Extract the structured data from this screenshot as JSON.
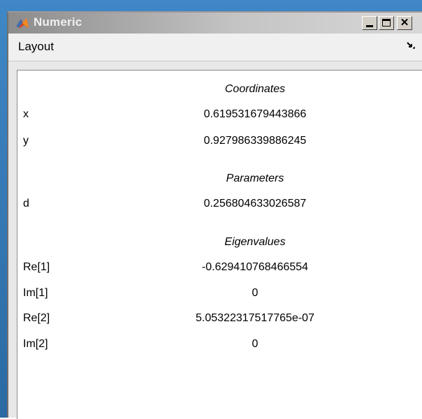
{
  "window": {
    "title": "Numeric"
  },
  "menu": {
    "layout_label": "Layout"
  },
  "sections": {
    "coordinates": {
      "header": "Coordinates",
      "rows": [
        {
          "label": "x",
          "value": "0.619531679443866"
        },
        {
          "label": "y",
          "value": "0.927986339886245"
        }
      ]
    },
    "parameters": {
      "header": "Parameters",
      "rows": [
        {
          "label": "d",
          "value": "0.256804633026587"
        }
      ]
    },
    "eigenvalues": {
      "header": "Eigenvalues",
      "rows": [
        {
          "label": "Re[1]",
          "value": "-0.629410768466554"
        },
        {
          "label": "Im[1]",
          "value": "0"
        },
        {
          "label": "Re[2]",
          "value": "5.05322317517765e-07"
        },
        {
          "label": "Im[2]",
          "value": "0"
        }
      ]
    }
  },
  "icons": {
    "app": "matlab-logo-icon",
    "minimize": "minimize-icon",
    "maximize": "maximize-icon",
    "close": "close-icon",
    "menu_dock": "dock-arrow-icon"
  },
  "colors": {
    "titlebar_inactive": "#8c8c8c",
    "content_background": "#ffffff",
    "menubar_background": "#f0f0f0"
  }
}
